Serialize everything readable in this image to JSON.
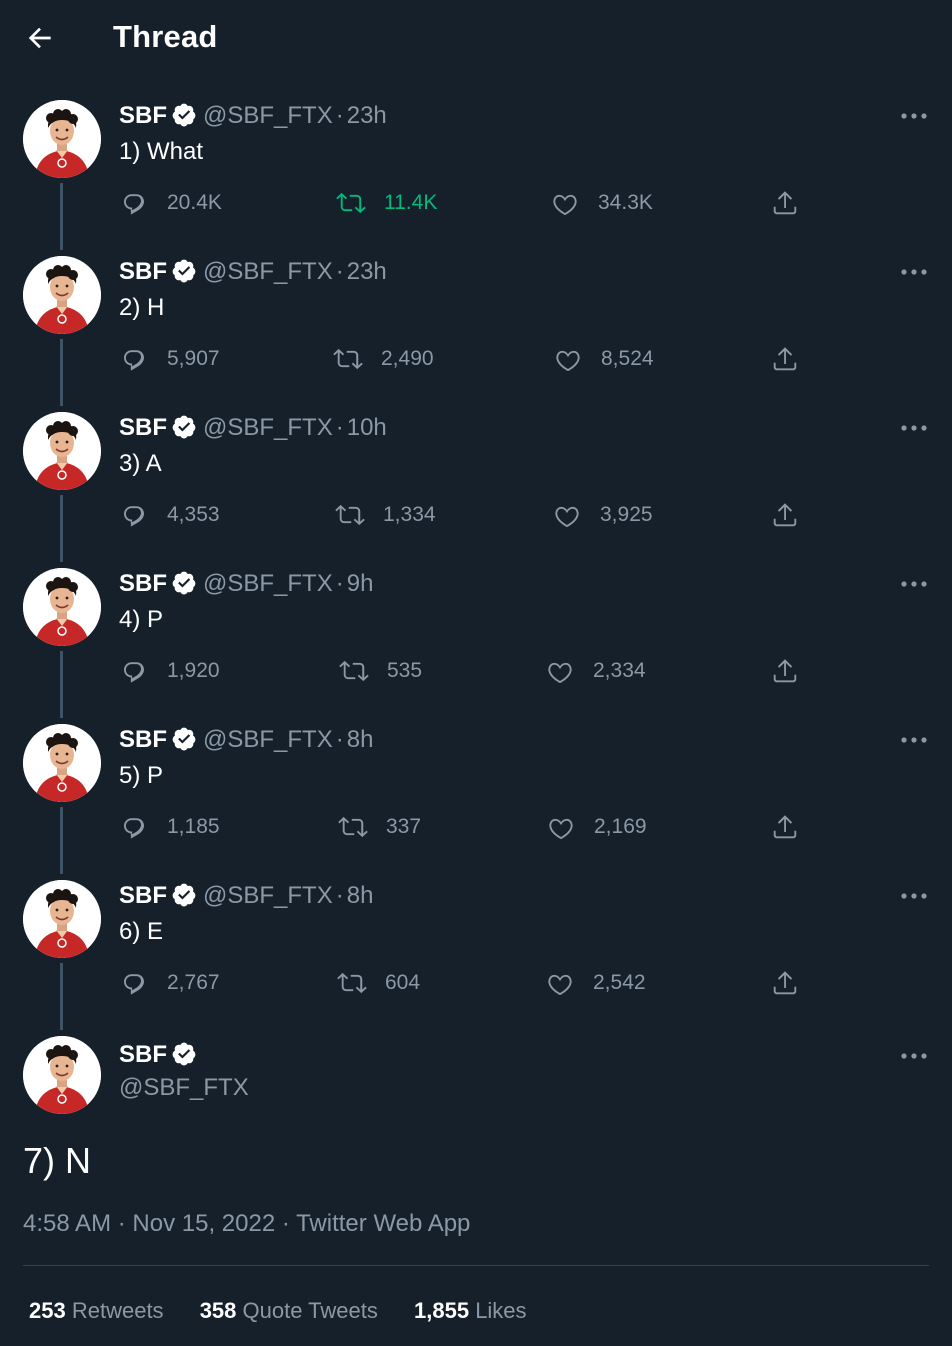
{
  "header": {
    "title": "Thread",
    "back_icon": "arrow-left-icon"
  },
  "author": {
    "name": "SBF",
    "handle": "@SBF_FTX",
    "verified_icon": "verified-badge-icon"
  },
  "tweets": [
    {
      "text": "1) What",
      "time": "23h",
      "replies": "20.4K",
      "retweets": "11.4K",
      "likes": "34.3K",
      "retweeted": true
    },
    {
      "text": "2) H",
      "time": "23h",
      "replies": "5,907",
      "retweets": "2,490",
      "likes": "8,524",
      "retweeted": false
    },
    {
      "text": "3) A",
      "time": "10h",
      "replies": "4,353",
      "retweets": "1,334",
      "likes": "3,925",
      "retweeted": false
    },
    {
      "text": "4) P",
      "time": "9h",
      "replies": "1,920",
      "retweets": "535",
      "likes": "2,334",
      "retweeted": false
    },
    {
      "text": "5) P",
      "time": "8h",
      "replies": "1,185",
      "retweets": "337",
      "likes": "2,169",
      "retweeted": false
    },
    {
      "text": "6) E",
      "time": "8h",
      "replies": "2,767",
      "retweets": "604",
      "likes": "2,542",
      "retweeted": false
    }
  ],
  "main_tweet": {
    "text": "7) N",
    "time": "4:58 AM",
    "date": "Nov 15, 2022",
    "source": "Twitter Web App",
    "stats": {
      "retweets_count": "253",
      "retweets_label": "Retweets",
      "quotes_count": "358",
      "quotes_label": "Quote Tweets",
      "likes_count": "1,855",
      "likes_label": "Likes"
    }
  },
  "separator": "·",
  "colors": {
    "background": "#15202b",
    "muted": "#8b98a5",
    "retweet_active": "#00ba7c",
    "verified": "#ffffff",
    "avatar_shirt": "#c62828"
  }
}
